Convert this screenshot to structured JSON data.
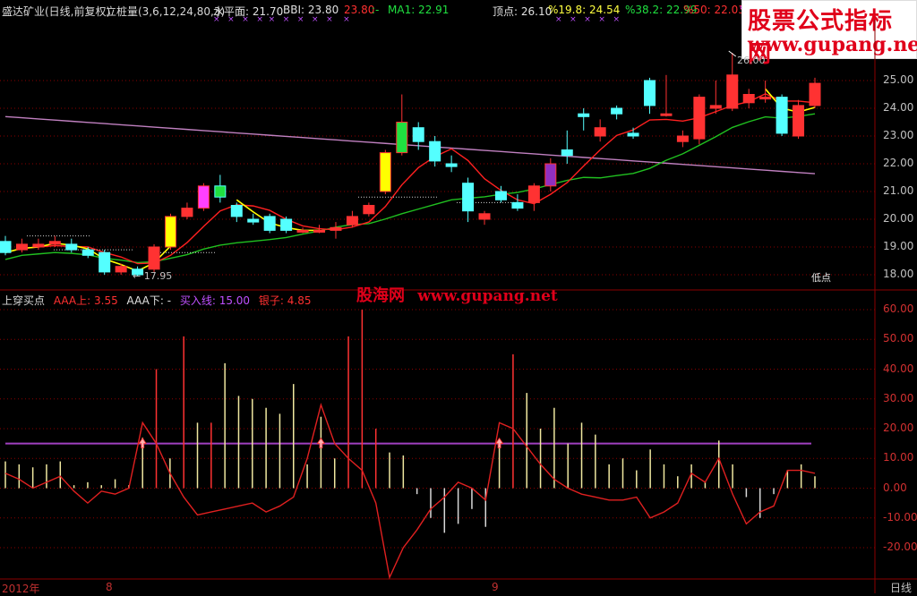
{
  "legend_main": {
    "title": "盛达矿业(日线,前复权)",
    "indicator": "立桩量(3,6,12,24,80,3)",
    "level_label": "水平面: 21.70",
    "bbi_label": "BBI: 23.80",
    "bbi_value2": "23.80",
    "dash": ":-",
    "ma1_label": "MA1: 22.91",
    "top_label": "顶点: 26.10",
    "pct198": "%19.8: 24.54",
    "pct382": "%38.2: 22.99",
    "pct50": "%50: 22.03",
    "pct_cut": "%"
  },
  "watermark": {
    "title": "股票公式指标网",
    "url": "www.gupang.net"
  },
  "annotations": {
    "high_price": "26.00",
    "low_price": "← 17.95",
    "low_point": "低点"
  },
  "axis_main": [
    "25.00",
    "24.00",
    "23.00",
    "22.00",
    "21.00",
    "20.00",
    "19.00",
    "18.00"
  ],
  "axis_sub": [
    "60.00",
    "50.00",
    "40.00",
    "30.00",
    "20.00",
    "10.00",
    "0.00",
    "-10.00",
    "-20.00"
  ],
  "legend_sub": {
    "name": "上穿买点",
    "aaa_up": "AAA上: 3.55",
    "aaa_down": "AAA下: -",
    "buy_line": "买入线: 15.00",
    "silver": "银子: 4.85"
  },
  "mid_watermark": {
    "text": "股海网",
    "url": "www.gupang.net"
  },
  "dates": {
    "year": "2012年",
    "m8": "8",
    "m9": "9",
    "period": "日线"
  },
  "colors": {
    "up": "#ff3232",
    "down": "#54ffff",
    "ma_yellow": "#ffff00",
    "ma_red": "#ff2020",
    "ma_green": "#20c020",
    "ma_violet": "#c080c0",
    "grid_red": "#8b0000",
    "buy_line": "#a040c0"
  },
  "chart_data": [
    {
      "type": "candlestick",
      "ylim": [
        17.5,
        26.5
      ],
      "candles": [
        {
          "o": 19.2,
          "c": 18.8,
          "h": 19.4,
          "l": 18.7
        },
        {
          "o": 18.9,
          "c": 19.1,
          "h": 19.3,
          "l": 18.8
        },
        {
          "o": 19.0,
          "c": 19.1,
          "h": 19.3,
          "l": 18.9
        },
        {
          "o": 19.1,
          "c": 19.2,
          "h": 19.4,
          "l": 19.0
        },
        {
          "o": 19.1,
          "c": 18.9,
          "h": 19.3,
          "l": 18.8
        },
        {
          "o": 18.9,
          "c": 18.7,
          "h": 19.0,
          "l": 18.6
        },
        {
          "o": 18.8,
          "c": 18.1,
          "h": 18.9,
          "l": 18.0
        },
        {
          "o": 18.1,
          "c": 18.3,
          "h": 18.4,
          "l": 18.0
        },
        {
          "o": 18.2,
          "c": 18.0,
          "h": 18.3,
          "l": 17.95
        },
        {
          "o": 18.2,
          "c": 19.0,
          "h": 19.1,
          "l": 18.1
        },
        {
          "o": 19.0,
          "c": 20.1,
          "h": 20.2,
          "l": 18.9
        },
        {
          "o": 20.1,
          "c": 20.4,
          "h": 20.6,
          "l": 20.0
        },
        {
          "o": 20.4,
          "c": 21.2,
          "h": 21.3,
          "l": 20.3
        },
        {
          "o": 21.2,
          "c": 20.8,
          "h": 21.6,
          "l": 20.6
        },
        {
          "o": 20.5,
          "c": 20.1,
          "h": 20.6,
          "l": 19.9
        },
        {
          "o": 20.0,
          "c": 19.9,
          "h": 20.2,
          "l": 19.8
        },
        {
          "o": 20.1,
          "c": 19.6,
          "h": 20.2,
          "l": 19.5
        },
        {
          "o": 20.0,
          "c": 19.6,
          "h": 20.1,
          "l": 19.5
        },
        {
          "o": 19.6,
          "c": 19.6,
          "h": 19.7,
          "l": 19.5
        },
        {
          "o": 19.6,
          "c": 19.6,
          "h": 19.8,
          "l": 19.5
        },
        {
          "o": 19.6,
          "c": 19.7,
          "h": 19.9,
          "l": 19.3
        },
        {
          "o": 19.8,
          "c": 20.1,
          "h": 20.3,
          "l": 19.7
        },
        {
          "o": 20.2,
          "c": 20.5,
          "h": 20.6,
          "l": 20.1
        },
        {
          "o": 21.0,
          "c": 22.4,
          "h": 22.5,
          "l": 20.9
        },
        {
          "o": 22.4,
          "c": 23.5,
          "h": 24.5,
          "l": 22.3
        },
        {
          "o": 23.3,
          "c": 22.8,
          "h": 23.5,
          "l": 22.5
        },
        {
          "o": 22.8,
          "c": 22.1,
          "h": 23.0,
          "l": 21.9
        },
        {
          "o": 22.0,
          "c": 21.9,
          "h": 22.3,
          "l": 21.7
        },
        {
          "o": 21.3,
          "c": 20.3,
          "h": 21.5,
          "l": 19.9
        },
        {
          "o": 20.0,
          "c": 20.2,
          "h": 20.3,
          "l": 19.8
        },
        {
          "o": 21.0,
          "c": 20.7,
          "h": 21.2,
          "l": 20.6
        },
        {
          "o": 20.6,
          "c": 20.4,
          "h": 20.9,
          "l": 20.3
        },
        {
          "o": 20.6,
          "c": 21.2,
          "h": 21.3,
          "l": 20.3
        },
        {
          "o": 21.2,
          "c": 22.0,
          "h": 22.2,
          "l": 21.0
        },
        {
          "o": 22.5,
          "c": 22.3,
          "h": 23.2,
          "l": 22.0
        },
        {
          "o": 23.8,
          "c": 23.7,
          "h": 24.0,
          "l": 23.2
        },
        {
          "o": 23.0,
          "c": 23.3,
          "h": 23.6,
          "l": 22.8
        },
        {
          "o": 24.0,
          "c": 23.8,
          "h": 24.1,
          "l": 23.6
        },
        {
          "o": 23.1,
          "c": 23.0,
          "h": 23.3,
          "l": 22.9
        },
        {
          "o": 25.0,
          "c": 24.1,
          "h": 25.1,
          "l": 23.8
        },
        {
          "o": 23.8,
          "c": 23.8,
          "h": 25.2,
          "l": 23.7
        },
        {
          "o": 22.8,
          "c": 23.0,
          "h": 23.2,
          "l": 22.6
        },
        {
          "o": 22.9,
          "c": 24.4,
          "h": 24.5,
          "l": 22.7
        },
        {
          "o": 24.0,
          "c": 24.1,
          "h": 25.0,
          "l": 23.8
        },
        {
          "o": 24.0,
          "c": 25.2,
          "h": 26.0,
          "l": 23.9
        },
        {
          "o": 24.2,
          "c": 24.5,
          "h": 24.7,
          "l": 24.0
        },
        {
          "o": 24.4,
          "c": 24.4,
          "h": 25.0,
          "l": 24.2
        },
        {
          "o": 24.4,
          "c": 23.1,
          "h": 24.5,
          "l": 23.0
        },
        {
          "o": 23.0,
          "c": 24.1,
          "h": 24.3,
          "l": 22.9
        },
        {
          "o": 24.1,
          "c": 24.9,
          "h": 25.1,
          "l": 24.0
        }
      ]
    },
    {
      "type": "bar",
      "title": "上穿买点",
      "ylim": [
        -25,
        65
      ],
      "buy_line": 15,
      "bars": [
        9,
        8,
        7,
        8,
        9,
        1,
        2,
        1,
        3,
        1,
        17,
        40,
        10,
        51,
        22,
        22,
        42,
        31,
        30,
        27,
        25,
        35,
        8,
        24,
        10,
        51,
        60,
        20,
        12,
        11,
        -2,
        -10,
        -15,
        -12,
        -7,
        -13,
        15,
        45,
        32,
        20,
        27,
        15,
        22,
        18,
        8,
        10,
        6,
        13,
        8,
        4,
        8,
        2,
        16,
        8,
        -3,
        -10,
        -2,
        6,
        8,
        4
      ],
      "line": [
        5,
        3,
        0,
        2,
        4,
        -1,
        -5,
        -1,
        -2,
        0,
        22,
        15,
        5,
        -3,
        -9,
        -8,
        -7,
        -6,
        -5,
        -8,
        -6,
        -3,
        10,
        28,
        15,
        10,
        6,
        -5,
        -30,
        -20,
        -14,
        -7,
        -3,
        2,
        0,
        -4,
        22,
        20,
        14,
        8,
        3,
        0,
        -2,
        -3,
        -4,
        -4,
        -3,
        -10,
        -8,
        -5,
        5,
        2,
        10,
        -2,
        -12,
        -8,
        -6,
        6,
        6,
        5
      ]
    }
  ]
}
